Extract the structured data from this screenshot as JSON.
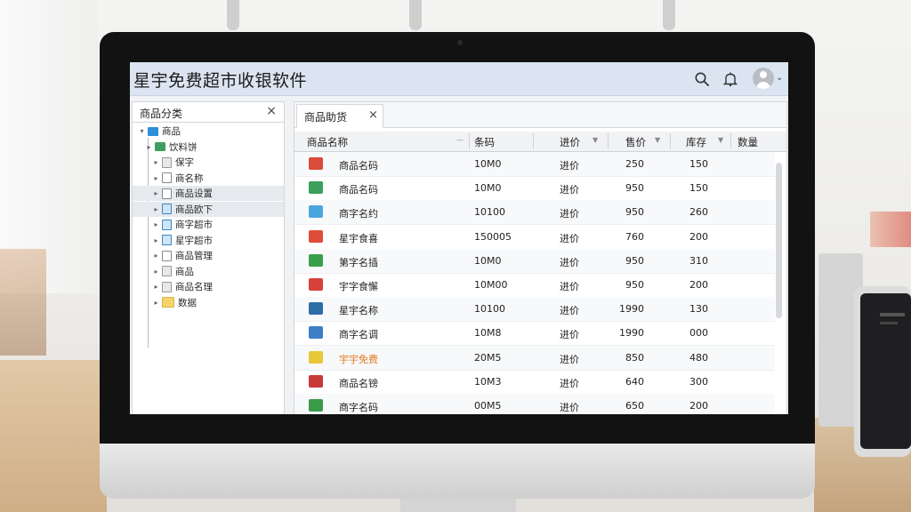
{
  "app": {
    "title": "星宇免费超市收银软件"
  },
  "header": {
    "icons": [
      "search-icon",
      "bell-icon",
      "user-avatar-icon",
      "chevron-down-icon"
    ]
  },
  "left_panel": {
    "title": "商品分类",
    "close": "×",
    "tree": [
      {
        "label": "商品",
        "icon": "folder-blue",
        "toggle": "▾"
      },
      {
        "label": "饮料饼",
        "icon": "folder-green",
        "toggle": "▸"
      },
      {
        "label": "保字",
        "icon": "doc-gray",
        "toggle": "▸"
      },
      {
        "label": "商名称",
        "icon": "doc",
        "toggle": "▸"
      },
      {
        "label": "商品设置",
        "icon": "doc",
        "toggle": "▸"
      },
      {
        "label": "商品欧下",
        "icon": "doc-blue",
        "toggle": "▸"
      },
      {
        "label": "商字超市",
        "icon": "doc-blue",
        "toggle": "▸"
      },
      {
        "label": "星宇超市",
        "icon": "doc-blue",
        "toggle": "▸"
      },
      {
        "label": "商品管理",
        "icon": "doc",
        "toggle": "▸"
      },
      {
        "label": "商品",
        "icon": "doc-gray",
        "toggle": "▸"
      },
      {
        "label": "商品名理",
        "icon": "doc-gray",
        "toggle": "▸"
      },
      {
        "label": "数据",
        "icon": "folder-yellow",
        "toggle": "▸"
      }
    ]
  },
  "right_panel": {
    "tab": {
      "label": "商品助货",
      "close": "×"
    },
    "columns": {
      "name": "商品名称",
      "code": "条码",
      "type": "进价",
      "sell": "售价",
      "stock": "库存",
      "qty": "数量"
    },
    "rows": [
      {
        "name": "商品名码",
        "code": "10M0",
        "type": "进价",
        "buy": "250",
        "sell": "150",
        "thumb": "#d94b3a",
        "orange": false
      },
      {
        "name": "商品名码",
        "code": "10M0",
        "type": "进价",
        "buy": "950",
        "sell": "150",
        "thumb": "#3aa05a",
        "orange": false
      },
      {
        "name": "商字名约",
        "code": "10100",
        "type": "进价",
        "buy": "950",
        "sell": "260",
        "thumb": "#4aa6e0",
        "orange": false
      },
      {
        "name": "星宇食喜",
        "code": "150005",
        "type": "进价",
        "buy": "760",
        "sell": "200",
        "thumb": "#e04c3a",
        "orange": false
      },
      {
        "name": "第字名插",
        "code": "10M0",
        "type": "进价",
        "buy": "950",
        "sell": "310",
        "thumb": "#3a9f4a",
        "orange": false
      },
      {
        "name": "宇字食懈",
        "code": "10M00",
        "type": "进价",
        "buy": "950",
        "sell": "200",
        "thumb": "#d8403a",
        "orange": false
      },
      {
        "name": "星宇名称",
        "code": "10100",
        "type": "进价",
        "buy": "1990",
        "sell": "130",
        "thumb": "#2c6ea8",
        "orange": false
      },
      {
        "name": "商字名调",
        "code": "10M8",
        "type": "进价",
        "buy": "1990",
        "sell": "000",
        "thumb": "#3d7ec9",
        "orange": false
      },
      {
        "name": "宇宇免费",
        "code": "20M5",
        "type": "进价",
        "buy": "850",
        "sell": "480",
        "thumb": "#e8c83a",
        "orange": true
      },
      {
        "name": "商品名镑",
        "code": "10M3",
        "type": "进价",
        "buy": "640",
        "sell": "300",
        "thumb": "#c83a3a",
        "orange": false
      },
      {
        "name": "商字名码",
        "code": "00M5",
        "type": "进价",
        "buy": "650",
        "sell": "200",
        "thumb": "#3a9a4a",
        "orange": false
      }
    ]
  }
}
